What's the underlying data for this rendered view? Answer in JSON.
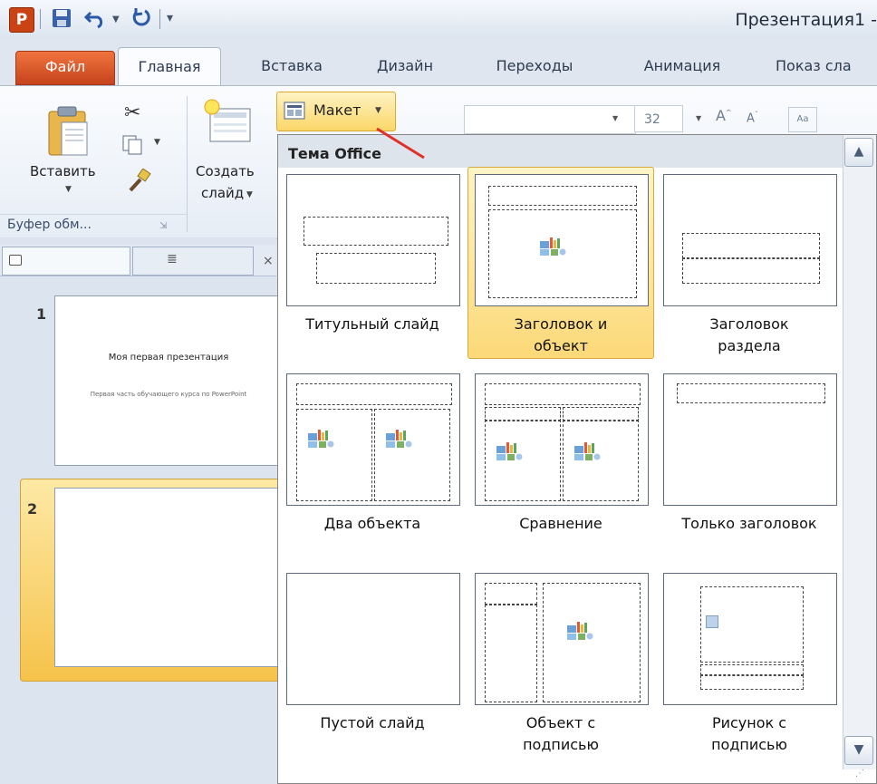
{
  "titlebar": {
    "doc_title": "Презентация1 -"
  },
  "tabs": [
    "Файл",
    "Главная",
    "Вставка",
    "Дизайн",
    "Переходы",
    "Анимация",
    "Показ сла"
  ],
  "ribbon": {
    "paste": "Вставить",
    "clipboard_group": "Буфер обм...",
    "create_slide_line1": "Создать",
    "create_slide_line2": "слайд",
    "layout_button": "Макет",
    "font_size": "32"
  },
  "slides": [
    {
      "number": "1",
      "title": "Моя первая презентация",
      "subtitle": "Первая часть обучающего курса по PowerPoint"
    },
    {
      "number": "2"
    }
  ],
  "gallery": {
    "header": "Тема Office",
    "layouts": [
      {
        "line1": "Титульный слайд",
        "line2": ""
      },
      {
        "line1": "Заголовок и",
        "line2": "объект"
      },
      {
        "line1": "Заголовок",
        "line2": "раздела"
      },
      {
        "line1": "Два объекта",
        "line2": ""
      },
      {
        "line1": "Сравнение",
        "line2": ""
      },
      {
        "line1": "Только заголовок",
        "line2": ""
      },
      {
        "line1": "Пустой слайд",
        "line2": ""
      },
      {
        "line1": "Объект с",
        "line2": "подписью"
      },
      {
        "line1": "Рисунок с",
        "line2": "подписью"
      }
    ],
    "selected_index": 1
  },
  "colors": {
    "file_tab": "#d8572a",
    "selection": "#fbd768",
    "accent_arrow": "#e0302a"
  }
}
